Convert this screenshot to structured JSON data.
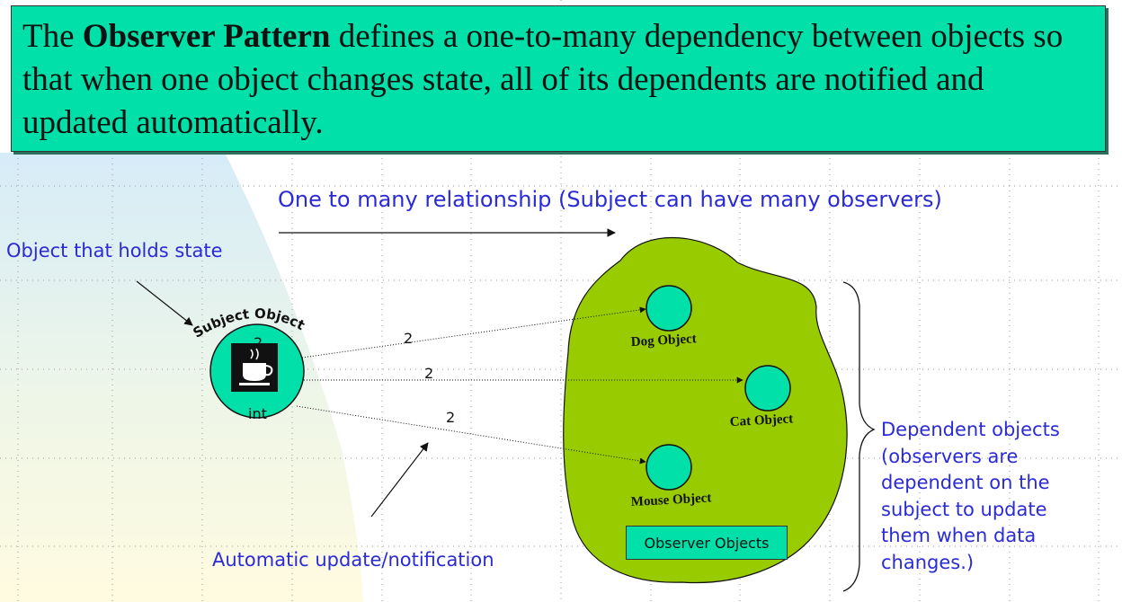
{
  "definition": {
    "before": "The ",
    "term": "Observer Pattern",
    "after": " defines a one-to-many dependency between objects so that when one object changes state, all of its dependents are notified and updated automatically."
  },
  "labels": {
    "relationship": "One to many relationship (Subject can have many observers)",
    "holds_state": "Object that holds state",
    "auto_update": "Automatic update/notification",
    "observer_objects": "Observer Objects"
  },
  "dependent_note": [
    "Dependent objects",
    "(observers are",
    "dependent on the",
    "subject to update",
    "them when data",
    "changes.)"
  ],
  "subject": {
    "title": "Subject Object",
    "value_top": "2",
    "value_type": "int"
  },
  "arrow_values": [
    "2",
    "2",
    "2"
  ],
  "observers": [
    "Dog Object",
    "Cat Object",
    "Mouse Object"
  ],
  "colors": {
    "teal": "#00e0a8",
    "blob": "#99cc00",
    "node": "#00e0a8",
    "label_blue": "#2b2bd6"
  }
}
